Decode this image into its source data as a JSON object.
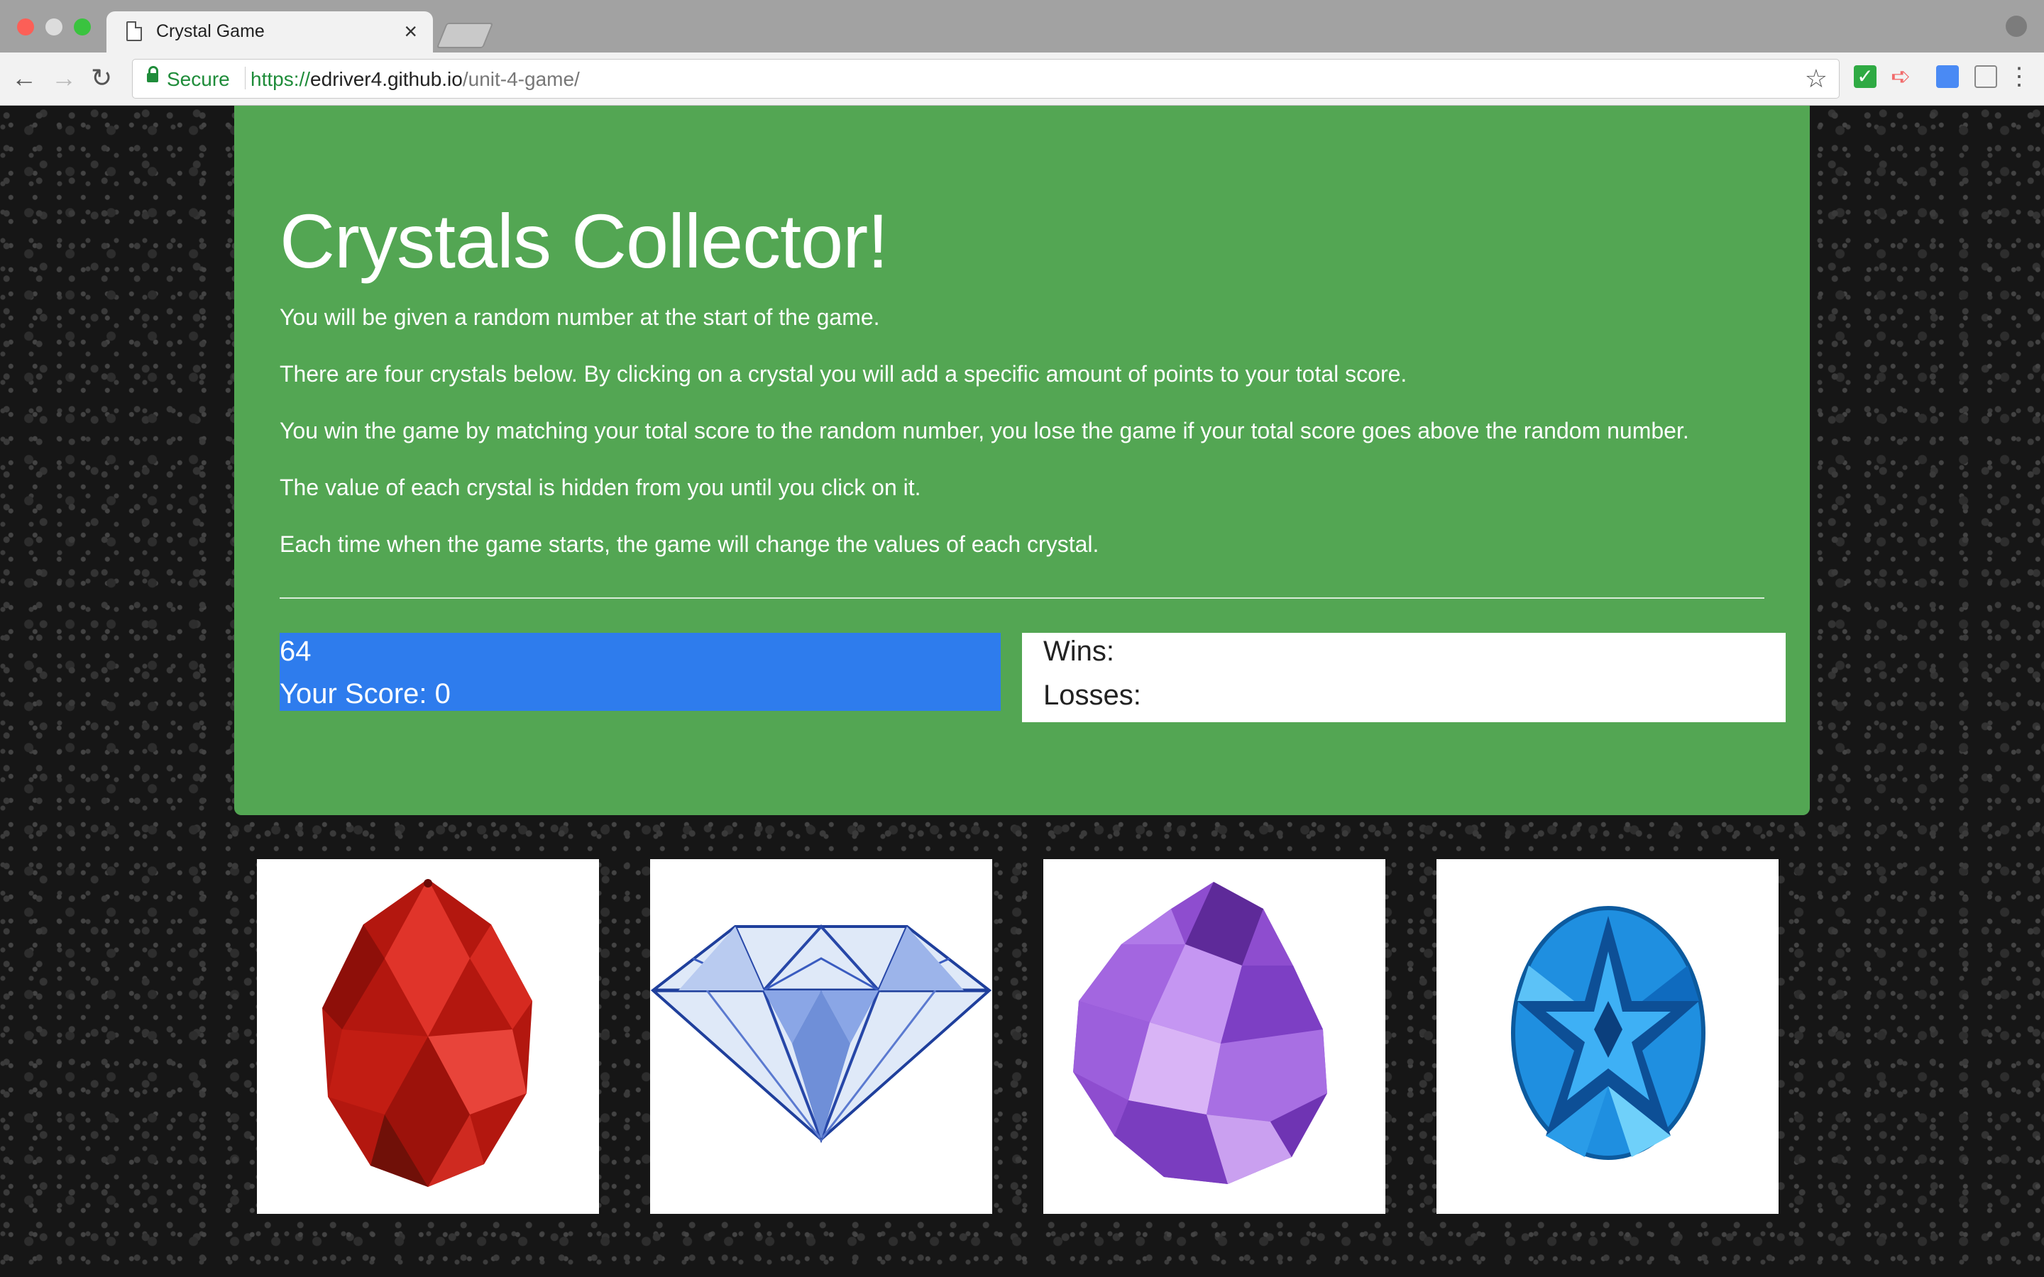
{
  "browser": {
    "tab_title": "Crystal Game",
    "tab_close": "×",
    "secure_label": "Secure",
    "url_scheme": "https://",
    "url_host": "edriver4.github.io",
    "url_path": "/unit-4-game/"
  },
  "game": {
    "title": "Crystals Collector!",
    "instructions": [
      "You will be given a random number at the start of the game.",
      "There are four crystals below. By clicking on a crystal you will add a specific amount of points to your total score.",
      "You win the game by matching your total score to the random number, you lose the game if your total score goes above the random number.",
      "The value of each crystal is hidden from you until you click on it.",
      "Each time when the game starts, the game will change the values of each crystal."
    ],
    "target_number": "64",
    "your_score": "Your Score: 0",
    "wins_label": "Wins:",
    "losses_label": "Losses:"
  },
  "crystals": [
    {
      "name": "red-crystal",
      "color": "#c8201a"
    },
    {
      "name": "diamond-crystal",
      "color": "#2747a8"
    },
    {
      "name": "purple-crystal",
      "color": "#9a5ad6"
    },
    {
      "name": "blue-crystal",
      "color": "#1f8fe0"
    }
  ],
  "colors": {
    "jumbotron_bg": "#53a653",
    "score_box_bg": "#2e7ced"
  }
}
